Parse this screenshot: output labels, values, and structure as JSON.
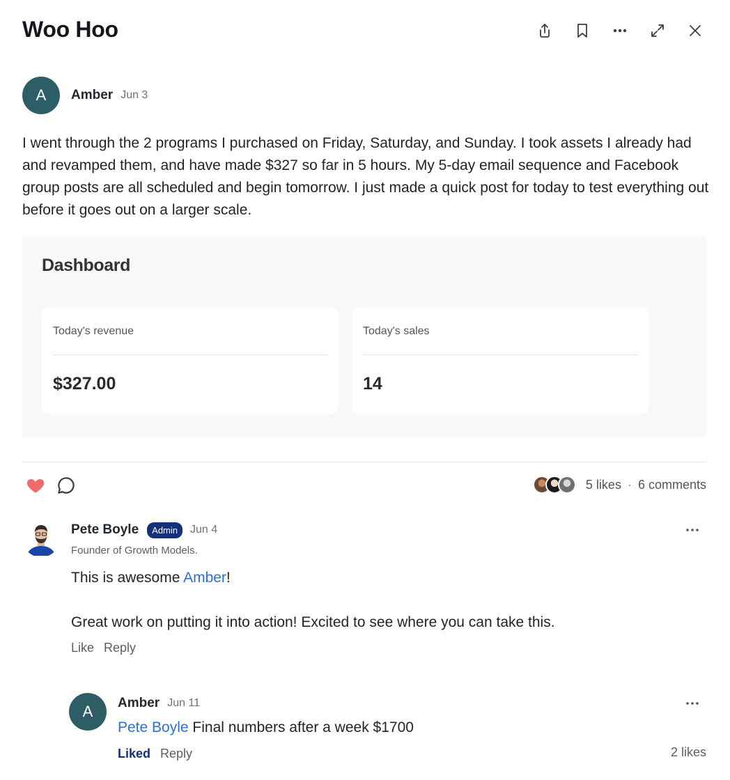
{
  "post": {
    "title": "Woo Hoo",
    "author_initial": "A",
    "author": "Amber",
    "date": "Jun 3",
    "body": "I went through the 2 programs I purchased on Friday, Saturday, and Sunday. I took assets I already had and revamped them, and have made $327 so far in 5 hours.  My 5-day email sequence and Facebook group posts are all scheduled and begin tomorrow.  I just made a quick post for today to test everything out before it goes out on a larger scale."
  },
  "header_icons": [
    "share-icon",
    "bookmark-icon",
    "more-icon",
    "expand-icon",
    "close-icon"
  ],
  "dashboard": {
    "title": "Dashboard",
    "cards": [
      {
        "label": "Today's revenue",
        "value": "$327.00"
      },
      {
        "label": "Today's sales",
        "value": "14"
      }
    ]
  },
  "engagement": {
    "likes": "5 likes",
    "separator": "·",
    "comments": "6 comments",
    "liked": true,
    "heart_color": "#ef6b6b"
  },
  "comments": [
    {
      "author": "Pete Boyle",
      "badge": "Admin",
      "date": "Jun 4",
      "subtitle": "Founder of Growth Models.",
      "text_before": "This is awesome ",
      "mention": "Amber",
      "text_after": "!",
      "text_para2": "Great work on putting it into action! Excited to see where you can take this.",
      "like_label": "Like",
      "reply_label": "Reply"
    },
    {
      "author_initial": "A",
      "author": "Amber",
      "date": "Jun 11",
      "mention": "Pete Boyle",
      "text": " Final numbers after a week $1700",
      "like_label": "Liked",
      "reply_label": "Reply",
      "likes": "2 likes"
    }
  ],
  "colors": {
    "accent": "#2d6fd6",
    "admin_badge": "#14307a",
    "avatar_bg": "#2d5e66"
  }
}
